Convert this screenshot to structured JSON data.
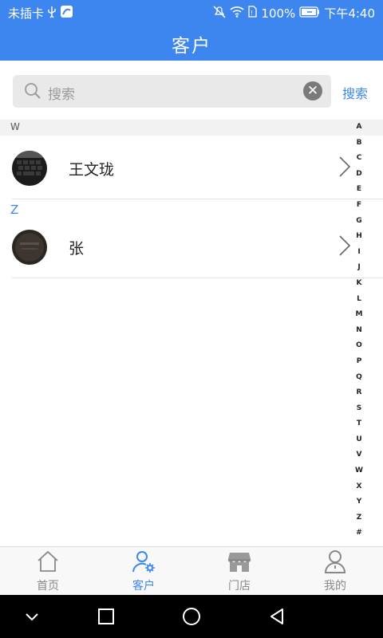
{
  "status_bar": {
    "carrier": "未插卡",
    "battery": "100%",
    "time": "下午4:40"
  },
  "header": {
    "title": "客户"
  },
  "search": {
    "placeholder": "搜索",
    "button_label": "搜索"
  },
  "sections": [
    {
      "letter": "W",
      "contacts": [
        {
          "name": "王文珑"
        }
      ]
    },
    {
      "letter": "Z",
      "contacts": [
        {
          "name": "张"
        }
      ]
    }
  ],
  "index_letters": [
    "A",
    "B",
    "C",
    "D",
    "E",
    "F",
    "G",
    "H",
    "I",
    "J",
    "K",
    "L",
    "M",
    "N",
    "O",
    "P",
    "Q",
    "R",
    "S",
    "T",
    "U",
    "V",
    "W",
    "X",
    "Y",
    "Z",
    "#"
  ],
  "tabs": [
    {
      "label": "首页",
      "icon": "home-icon",
      "active": false
    },
    {
      "label": "客户",
      "icon": "customer-gear-icon",
      "active": true
    },
    {
      "label": "门店",
      "icon": "store-icon",
      "active": false
    },
    {
      "label": "我的",
      "icon": "profile-icon",
      "active": false
    }
  ],
  "colors": {
    "primary": "#3d86f0",
    "tab_inactive": "#888888"
  }
}
